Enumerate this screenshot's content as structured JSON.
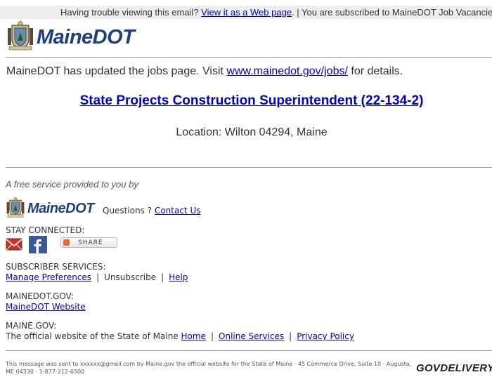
{
  "topbar": {
    "prefix": "Having trouble viewing this email?",
    "link": "View it as a Web page",
    "suffix": ". | You are subscribed to MaineDOT Job Vacancies"
  },
  "brand": {
    "name": "MaineDOT"
  },
  "intro": {
    "prefix": "MaineDOT has updated the jobs page. Visit",
    "link": "www.mainedot.gov/jobs/",
    "suffix": "for details."
  },
  "job": {
    "title": "State Projects Construction Superintendent (22-134-2)",
    "location": "Location: Wilton 04294, Maine"
  },
  "footer": {
    "free_service": "A free service provided to you by",
    "questions": "Questions ?",
    "contact_link": "Contact Us",
    "stay_connected": "STAY CONNECTED:",
    "share_label": "SHARE",
    "subscriber_services": "SUBSCRIBER SERVICES:",
    "manage_preferences": "Manage Preferences",
    "unsubscribe": "Unsubscribe",
    "help": "Help",
    "mainedot_gov": "MAINEDOT.GOV:",
    "mainedot_website": "MaineDOT Website",
    "maine_gov": "MAINE.GOV:",
    "official_site_text": "The official website of the State of Maine",
    "home": "Home",
    "online_services": "Online Services",
    "privacy_policy": "Privacy Policy",
    "sent_to": "This message was sent to xxxxxx@gmail.com by Maine.gov the official website for the State of Maine · 45 Commerce Drive, Suite 10 · Augusta, ME 04330 · 1-877-212-6500",
    "govdelivery": "GOVDELIVERY"
  },
  "separators": {
    "pipe": "|"
  },
  "colors": {
    "brand_blue": "#1f3f7a",
    "link": "#0000cc",
    "topbar_bg": "#eeeeee"
  }
}
